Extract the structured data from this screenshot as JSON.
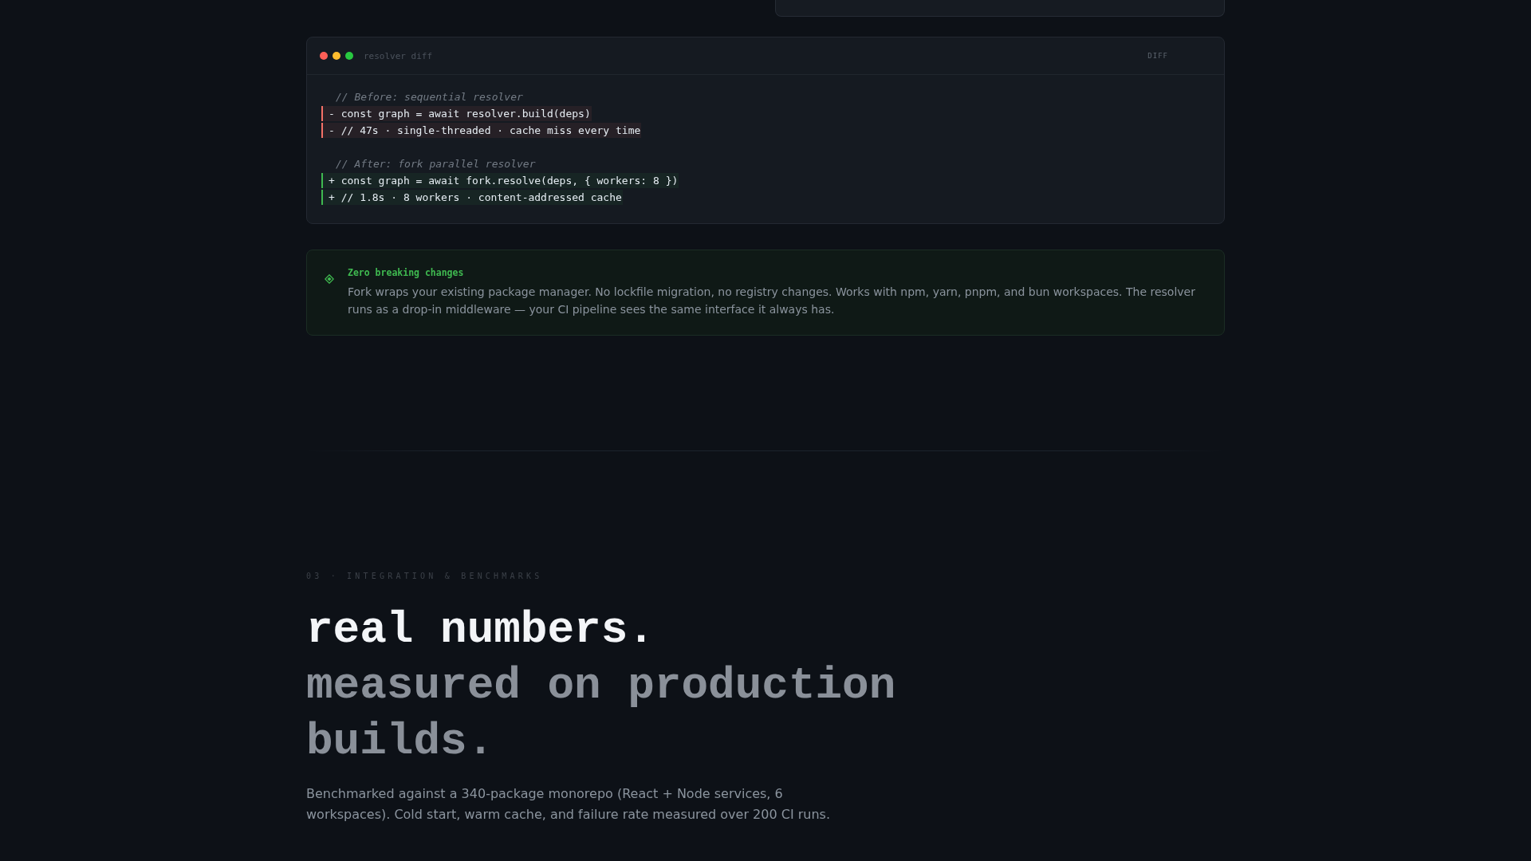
{
  "diff_panel": {
    "title": "resolver diff",
    "badge": "DIFF",
    "lines": [
      {
        "kind": "comment",
        "text": "// Before: sequential resolver"
      },
      {
        "kind": "removed",
        "text": "- const graph = await resolver.build(deps)"
      },
      {
        "kind": "removed",
        "text": "- // 47s · single-threaded · cache miss every time"
      },
      {
        "kind": "blank"
      },
      {
        "kind": "comment",
        "text": "// After: fork parallel resolver"
      },
      {
        "kind": "added",
        "text": "+ const graph = await fork.resolve(deps, { workers: 8 })"
      },
      {
        "kind": "added",
        "text": "+ // 1.8s · 8 workers · content-addressed cache"
      }
    ]
  },
  "callout": {
    "title": "Zero breaking changes",
    "text": "Fork wraps your existing package manager. No lockfile migration, no registry changes. Works with npm, yarn, pnpm, and bun workspaces. The resolver runs as a drop-in middleware — your CI pipeline sees the same interface it always has."
  },
  "section": {
    "eyebrow": "03 · INTEGRATION & BENCHMARKS",
    "heading": [
      {
        "kind": "primary",
        "text": "real numbers."
      },
      {
        "kind": "muted",
        "text": "measured on production builds."
      }
    ],
    "description": "Benchmarked against a 340-package monorepo (React + Node services, 6 workspaces). Cold start, warm cache, and failure rate measured over 200 CI runs."
  }
}
